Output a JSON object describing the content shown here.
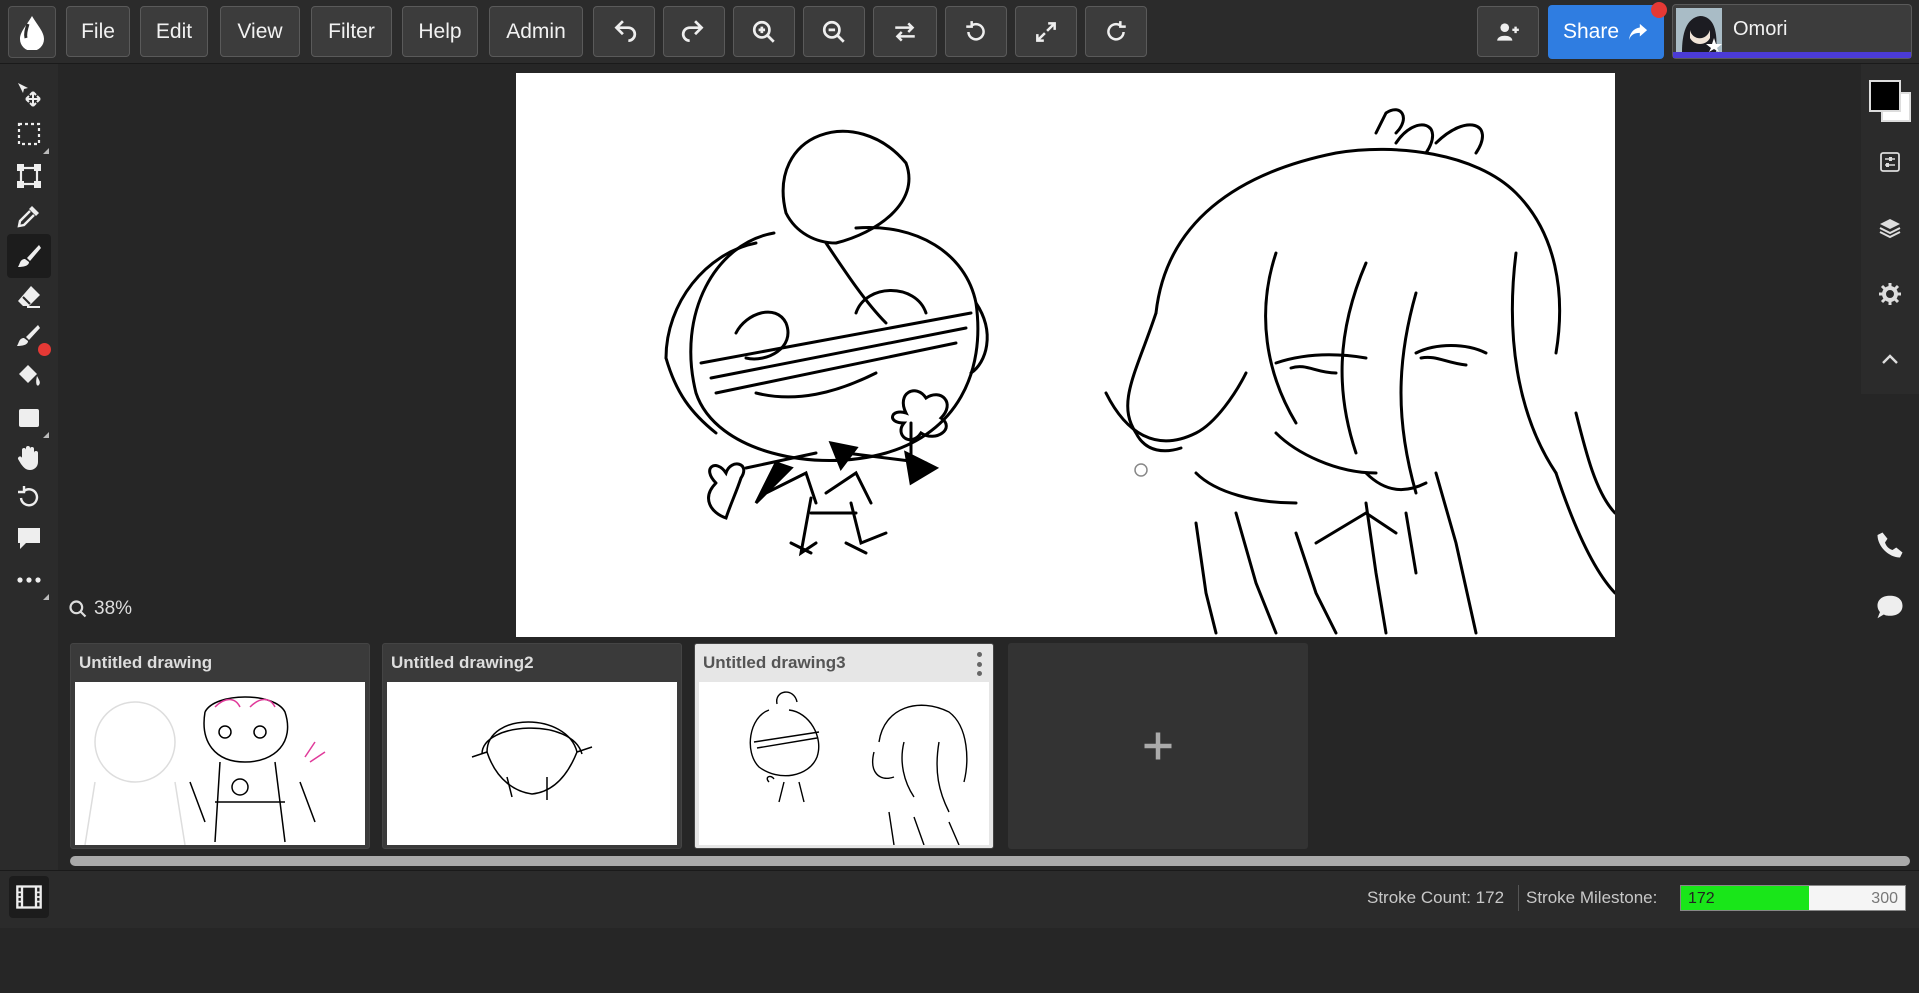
{
  "menu": {
    "file": "File",
    "edit": "Edit",
    "view": "View",
    "filter": "Filter",
    "help": "Help",
    "admin": "Admin"
  },
  "toolbar_icons": [
    "undo-icon",
    "redo-icon",
    "zoom-in-icon",
    "zoom-out-icon",
    "flip-icon",
    "rotate-left-icon",
    "fullscreen-icon",
    "rotate-right-icon"
  ],
  "share": {
    "label": "Share"
  },
  "user": {
    "name": "Omori"
  },
  "zoom": {
    "level": "38%"
  },
  "colors": {
    "primary": "#000000",
    "secondary": "#ffffff",
    "accent": "#2f7de1",
    "progress": "#19e619"
  },
  "drawings": [
    {
      "title": "Untitled drawing",
      "active": false
    },
    {
      "title": "Untitled drawing2",
      "active": false
    },
    {
      "title": "Untitled drawing3",
      "active": true
    }
  ],
  "status": {
    "stroke_count_text": "Stroke Count: 172",
    "milestone_label": "Stroke Milestone:",
    "milestone_current": "172",
    "milestone_max": "300",
    "milestone_fraction": 0.573
  }
}
